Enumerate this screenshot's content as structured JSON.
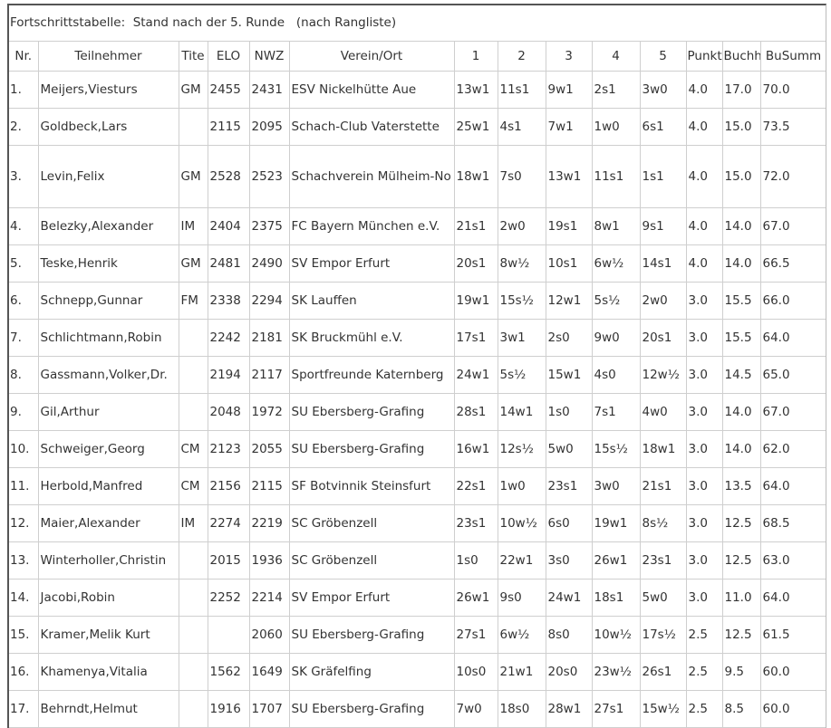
{
  "caption": "Fortschrittstabelle:  Stand nach der 5. Runde   (nach Rangliste)",
  "columns": {
    "nr": "Nr.",
    "name": "Teilnehmer",
    "title": "Tite",
    "elo": "ELO",
    "nwz": "NWZ",
    "club": "Verein/Ort",
    "r1": "1",
    "r2": "2",
    "r3": "3",
    "r4": "4",
    "r5": "5",
    "pts": "Punkt",
    "buchh": "Buchh",
    "busumm": "BuSumm"
  },
  "rows": [
    {
      "nr": "1.",
      "name": "Meijers,Viesturs",
      "title": "GM",
      "elo": "2455",
      "nwz": "2431",
      "club": "ESV Nickelhütte Aue",
      "r1": "13w1",
      "r2": "11s1",
      "r3": "9w1",
      "r4": "2s1",
      "r5": "3w0",
      "pts": "4.0",
      "buchh": "17.0",
      "busumm": "70.0"
    },
    {
      "nr": "2.",
      "name": "Goldbeck,Lars",
      "title": "",
      "elo": "2115",
      "nwz": "2095",
      "club": "Schach-Club Vaterstette",
      "r1": "25w1",
      "r2": "4s1",
      "r3": "7w1",
      "r4": "1w0",
      "r5": "6s1",
      "pts": "4.0",
      "buchh": "15.0",
      "busumm": "73.5"
    },
    {
      "nr": "3.",
      "name": "Levin,Felix",
      "title": "GM",
      "elo": "2528",
      "nwz": "2523",
      "club": "Schachverein Mülheim-No",
      "r1": "18w1",
      "r2": "7s0",
      "r3": "13w1",
      "r4": "11s1",
      "r5": "1s1",
      "pts": "4.0",
      "buchh": "15.0",
      "busumm": "72.0"
    },
    {
      "nr": "4.",
      "name": "Belezky,Alexander",
      "title": "IM",
      "elo": "2404",
      "nwz": "2375",
      "club": "FC Bayern München e.V.",
      "r1": "21s1",
      "r2": "2w0",
      "r3": "19s1",
      "r4": "8w1",
      "r5": "9s1",
      "pts": "4.0",
      "buchh": "14.0",
      "busumm": "67.0"
    },
    {
      "nr": "5.",
      "name": "Teske,Henrik",
      "title": "GM",
      "elo": "2481",
      "nwz": "2490",
      "club": "SV Empor Erfurt",
      "r1": "20s1",
      "r2": "8w½",
      "r3": "10s1",
      "r4": "6w½",
      "r5": "14s1",
      "pts": "4.0",
      "buchh": "14.0",
      "busumm": "66.5"
    },
    {
      "nr": "6.",
      "name": "Schnepp,Gunnar",
      "title": "FM",
      "elo": "2338",
      "nwz": "2294",
      "club": "SK Lauffen",
      "r1": "19w1",
      "r2": "15s½",
      "r3": "12w1",
      "r4": "5s½",
      "r5": "2w0",
      "pts": "3.0",
      "buchh": "15.5",
      "busumm": "66.0"
    },
    {
      "nr": "7.",
      "name": "Schlichtmann,Robin",
      "title": "",
      "elo": "2242",
      "nwz": "2181",
      "club": "SK Bruckmühl e.V.",
      "r1": "17s1",
      "r2": "3w1",
      "r3": "2s0",
      "r4": "9w0",
      "r5": "20s1",
      "pts": "3.0",
      "buchh": "15.5",
      "busumm": "64.0"
    },
    {
      "nr": "8.",
      "name": "Gassmann,Volker,Dr.",
      "title": "",
      "elo": "2194",
      "nwz": "2117",
      "club": "Sportfreunde Katernberg",
      "r1": "24w1",
      "r2": "5s½",
      "r3": "15w1",
      "r4": "4s0",
      "r5": "12w½",
      "pts": "3.0",
      "buchh": "14.5",
      "busumm": "65.0"
    },
    {
      "nr": "9.",
      "name": "Gil,Arthur",
      "title": "",
      "elo": "2048",
      "nwz": "1972",
      "club": "SU Ebersberg-Grafing",
      "r1": "28s1",
      "r2": "14w1",
      "r3": "1s0",
      "r4": "7s1",
      "r5": "4w0",
      "pts": "3.0",
      "buchh": "14.0",
      "busumm": "67.0"
    },
    {
      "nr": "10.",
      "name": "Schweiger,Georg",
      "title": "CM",
      "elo": "2123",
      "nwz": "2055",
      "club": "SU Ebersberg-Grafing",
      "r1": "16w1",
      "r2": "12s½",
      "r3": "5w0",
      "r4": "15s½",
      "r5": "18w1",
      "pts": "3.0",
      "buchh": "14.0",
      "busumm": "62.0"
    },
    {
      "nr": "11.",
      "name": "Herbold,Manfred",
      "title": "CM",
      "elo": "2156",
      "nwz": "2115",
      "club": "SF Botvinnik Steinsfurt",
      "r1": "22s1",
      "r2": "1w0",
      "r3": "23s1",
      "r4": "3w0",
      "r5": "21s1",
      "pts": "3.0",
      "buchh": "13.5",
      "busumm": "64.0"
    },
    {
      "nr": "12.",
      "name": "Maier,Alexander",
      "title": "IM",
      "elo": "2274",
      "nwz": "2219",
      "club": "SC Gröbenzell",
      "r1": "23s1",
      "r2": "10w½",
      "r3": "6s0",
      "r4": "19w1",
      "r5": "8s½",
      "pts": "3.0",
      "buchh": "12.5",
      "busumm": "68.5"
    },
    {
      "nr": "13.",
      "name": "Winterholler,Christin",
      "title": "",
      "elo": "2015",
      "nwz": "1936",
      "club": "SC Gröbenzell",
      "r1": "1s0",
      "r2": "22w1",
      "r3": "3s0",
      "r4": "26w1",
      "r5": "23s1",
      "pts": "3.0",
      "buchh": "12.5",
      "busumm": "63.0"
    },
    {
      "nr": "14.",
      "name": "Jacobi,Robin",
      "title": "",
      "elo": "2252",
      "nwz": "2214",
      "club": "SV Empor Erfurt",
      "r1": "26w1",
      "r2": "9s0",
      "r3": "24w1",
      "r4": "18s1",
      "r5": "5w0",
      "pts": "3.0",
      "buchh": "11.0",
      "busumm": "64.0"
    },
    {
      "nr": "15.",
      "name": "Kramer,Melik Kurt",
      "title": "",
      "elo": "",
      "nwz": "2060",
      "club": "SU Ebersberg-Grafing",
      "r1": "27s1",
      "r2": "6w½",
      "r3": "8s0",
      "r4": "10w½",
      "r5": "17s½",
      "pts": "2.5",
      "buchh": "12.5",
      "busumm": "61.5"
    },
    {
      "nr": "16.",
      "name": "Khamenya,Vitalia",
      "title": "",
      "elo": "1562",
      "nwz": "1649",
      "club": "SK Gräfelfing",
      "r1": "10s0",
      "r2": "21w1",
      "r3": "20s0",
      "r4": "23w½",
      "r5": "26s1",
      "pts": "2.5",
      "buchh": "9.5",
      "busumm": "60.0"
    },
    {
      "nr": "17.",
      "name": "Behrndt,Helmut",
      "title": "",
      "elo": "1916",
      "nwz": "1707",
      "club": "SU Ebersberg-Grafing",
      "r1": "7w0",
      "r2": "18s0",
      "r3": "28w1",
      "r4": "27s1",
      "r5": "15w½",
      "pts": "2.5",
      "buchh": "8.5",
      "busumm": "60.0"
    }
  ]
}
